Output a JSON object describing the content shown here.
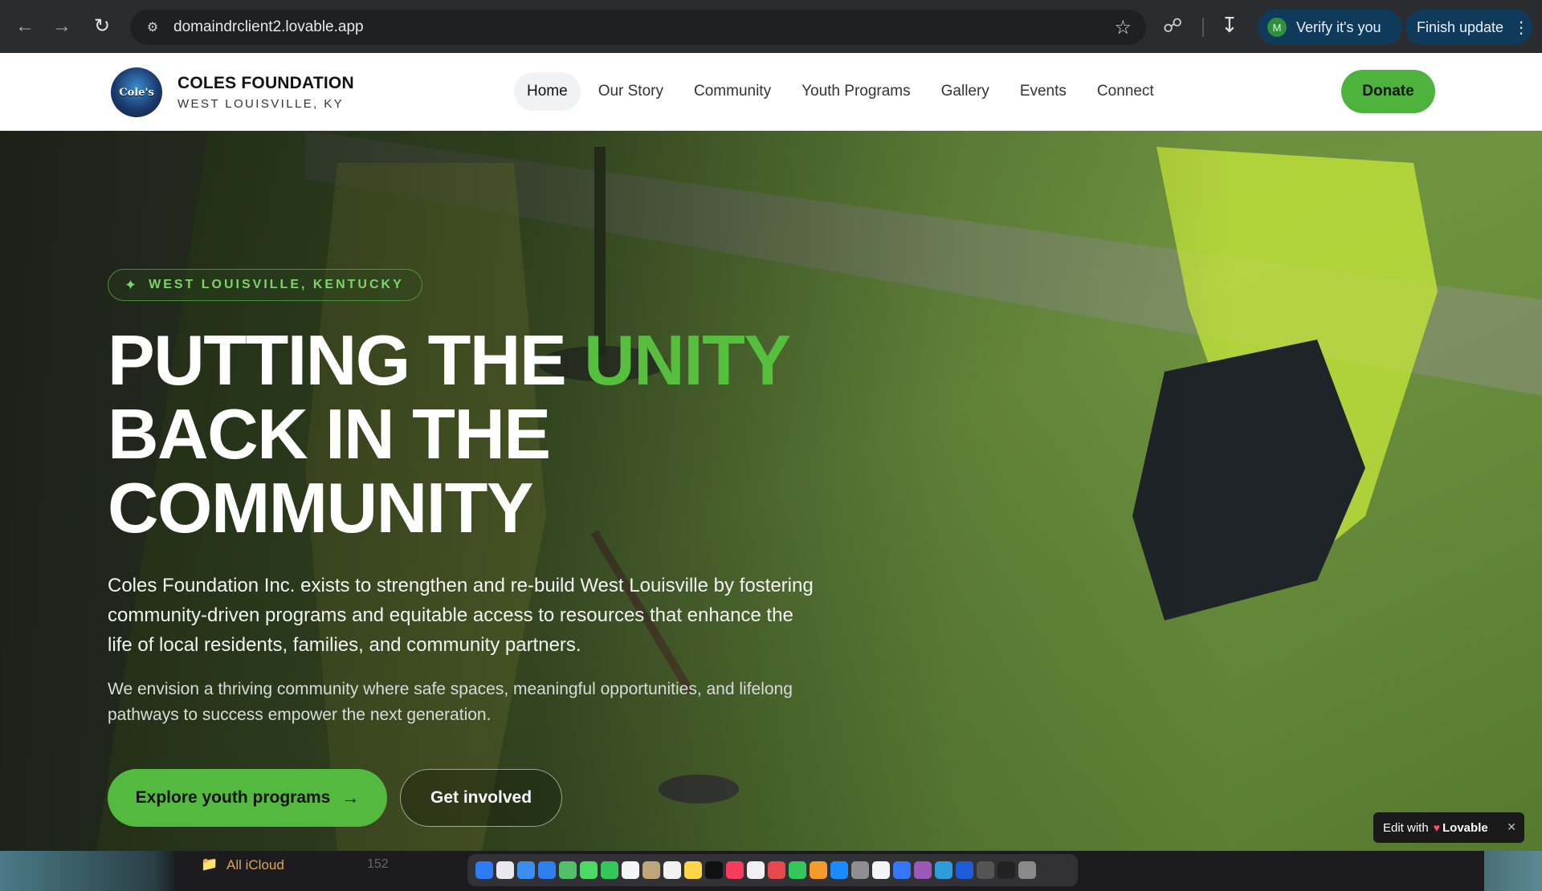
{
  "browser": {
    "url": "domaindrclient2.lovable.app",
    "verify_label": "Verify it's you",
    "verify_avatar": "M",
    "update_label": "Finish update"
  },
  "site": {
    "brand_name": "COLES FOUNDATION",
    "brand_sub": "WEST LOUISVILLE, KY",
    "logo_text": "Cole's",
    "nav": [
      {
        "label": "Home",
        "active": true
      },
      {
        "label": "Our Story"
      },
      {
        "label": "Community"
      },
      {
        "label": "Youth Programs"
      },
      {
        "label": "Gallery"
      },
      {
        "label": "Events"
      },
      {
        "label": "Connect"
      }
    ],
    "donate_label": "Donate"
  },
  "hero": {
    "location": "WEST LOUISVILLE, KENTUCKY",
    "headline_part1": "PUTTING THE ",
    "headline_accent": "UNITY",
    "headline_line2": "BACK IN THE",
    "headline_line3": "COMMUNITY",
    "lead": "Coles Foundation Inc. exists to strengthen and re-build West Louisville by fostering community-driven programs and equitable access to resources that enhance the life of local residents, families, and community partners.",
    "vision": "We envision a thriving community where safe spaces, meaningful opportunities, and lifelong pathways to success empower the next generation.",
    "primary_cta": "Explore youth programs",
    "secondary_cta": "Get involved"
  },
  "lovable_badge": {
    "prefix": "Edit with",
    "brand": "Lovable"
  },
  "desktop": {
    "folder_label": "All iCloud",
    "folder_count": "152"
  },
  "colors": {
    "accent_green": "#56bf3e",
    "browser_pill": "#0f3a5c"
  }
}
